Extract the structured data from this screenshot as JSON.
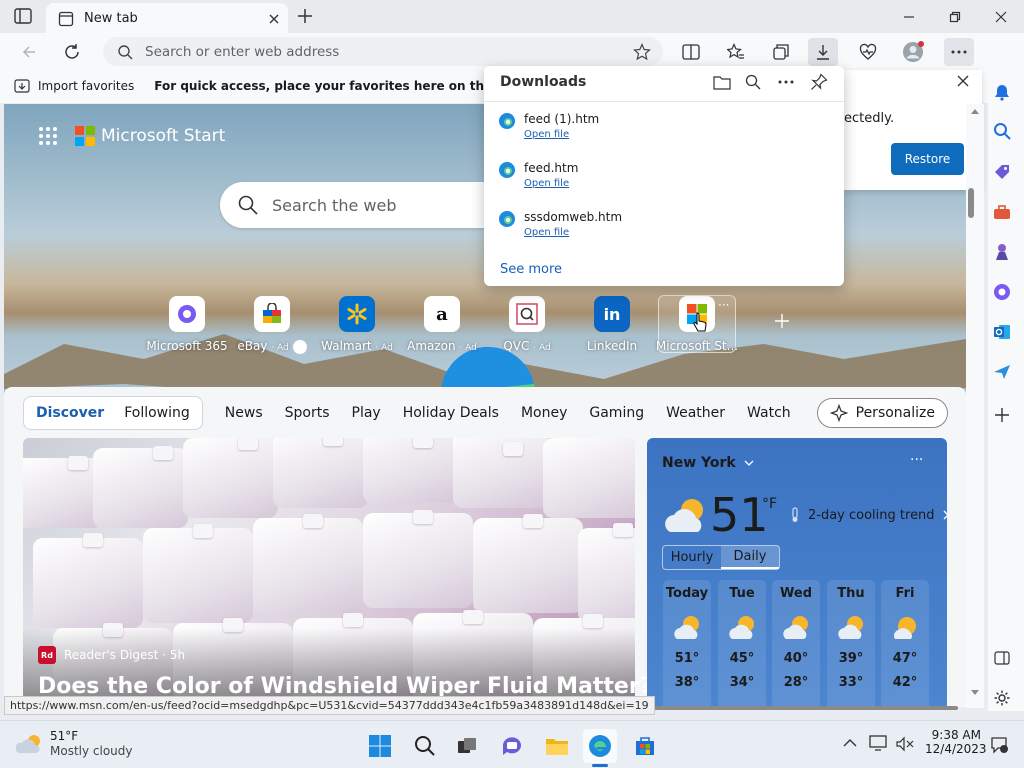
{
  "browser": {
    "tab_title": "New tab",
    "address_placeholder": "Search or enter web address"
  },
  "favorites_bar": {
    "import_label": "Import favorites",
    "hint": "For quick access, place your favorites here on the favorites bar."
  },
  "downloads": {
    "title": "Downloads",
    "items": [
      {
        "name": "feed (1).htm",
        "action": "Open file"
      },
      {
        "name": "feed.htm",
        "action": "Open file"
      },
      {
        "name": "sssdomweb.htm",
        "action": "Open file"
      }
    ],
    "see_more": "See more"
  },
  "restore_card": {
    "text": "ectedly.",
    "button": "Restore"
  },
  "start": {
    "brand": "Microsoft Start",
    "search_placeholder": "Search the web",
    "tiles": [
      {
        "label": "Microsoft 365",
        "ad": ""
      },
      {
        "label": "eBay",
        "ad": "· Ad"
      },
      {
        "label": "Walmart",
        "ad": "· Ad"
      },
      {
        "label": "Amazon",
        "ad": "· Ad"
      },
      {
        "label": "QVC",
        "ad": "· Ad"
      },
      {
        "label": "LinkedIn",
        "ad": ""
      },
      {
        "label": "Microsoft St...",
        "ad": ""
      }
    ]
  },
  "feed_nav": {
    "pill": [
      "Discover",
      "Following"
    ],
    "items": [
      "News",
      "Sports",
      "Play",
      "Holiday Deals",
      "Money",
      "Gaming",
      "Weather",
      "Watch",
      "···"
    ],
    "personalize": "Personalize"
  },
  "article": {
    "source_logo": "Rd",
    "source": "Reader's Digest · 5h",
    "headline": "Does the Color of Windshield Wiper Fluid Matter?"
  },
  "weather": {
    "city": "New York",
    "temp": "51",
    "unit": "°F",
    "trend": "2-day cooling trend",
    "tabs": [
      "Hourly",
      "Daily"
    ],
    "days": [
      {
        "day": "Today",
        "hi": "51°",
        "lo": "38°"
      },
      {
        "day": "Tue",
        "hi": "45°",
        "lo": "34°"
      },
      {
        "day": "Wed",
        "hi": "40°",
        "lo": "28°"
      },
      {
        "day": "Thu",
        "hi": "39°",
        "lo": "33°"
      },
      {
        "day": "Fri",
        "hi": "47°",
        "lo": "42°"
      }
    ]
  },
  "status_url": "https://www.msn.com/en-us/feed?ocid=msedgdhp&pc=U531&cvid=54377ddd343e4c1fb59a3483891d148d&ei=19",
  "taskbar": {
    "weather_temp": "51°F",
    "weather_desc": "Mostly cloudy",
    "time": "9:38 AM",
    "date": "12/4/2023"
  },
  "colors": {
    "accent": "#0f6cbd",
    "link": "#1a5fb4",
    "weather_bg": "#3c73c2"
  }
}
